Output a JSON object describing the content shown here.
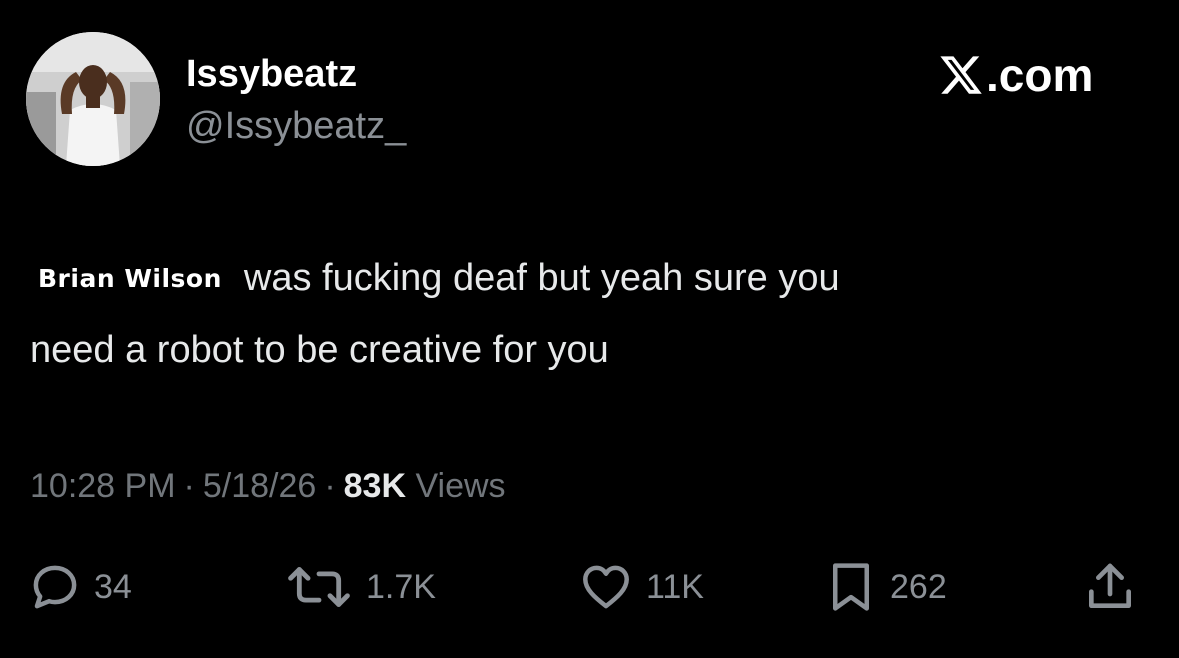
{
  "author": {
    "display_name": "Issybeatz",
    "handle": "@Issybeatz_",
    "avatar_icon": "avatar-image"
  },
  "brand": {
    "logo_icon": "x-logo-icon",
    "text": ".com"
  },
  "tweet": {
    "sticker_label": "Brian Wilson",
    "line1": "was fucking deaf but yeah sure you",
    "line2": "need a robot to be creative for you"
  },
  "meta": {
    "time": "10:28 PM",
    "separator": "·",
    "date": "5/18/26",
    "views_count": "83K",
    "views_label": "Views"
  },
  "actions": {
    "replies": {
      "icon": "reply-icon",
      "count": "34"
    },
    "reposts": {
      "icon": "repost-icon",
      "count": "1.7K"
    },
    "likes": {
      "icon": "heart-icon",
      "count": "11K"
    },
    "bookmarks": {
      "icon": "bookmark-icon",
      "count": "262"
    },
    "share": {
      "icon": "share-icon"
    }
  },
  "colors": {
    "background": "#000000",
    "primary_text": "#e7e9ea",
    "secondary_text": "#71767b",
    "icon_gray": "#8b9096"
  }
}
